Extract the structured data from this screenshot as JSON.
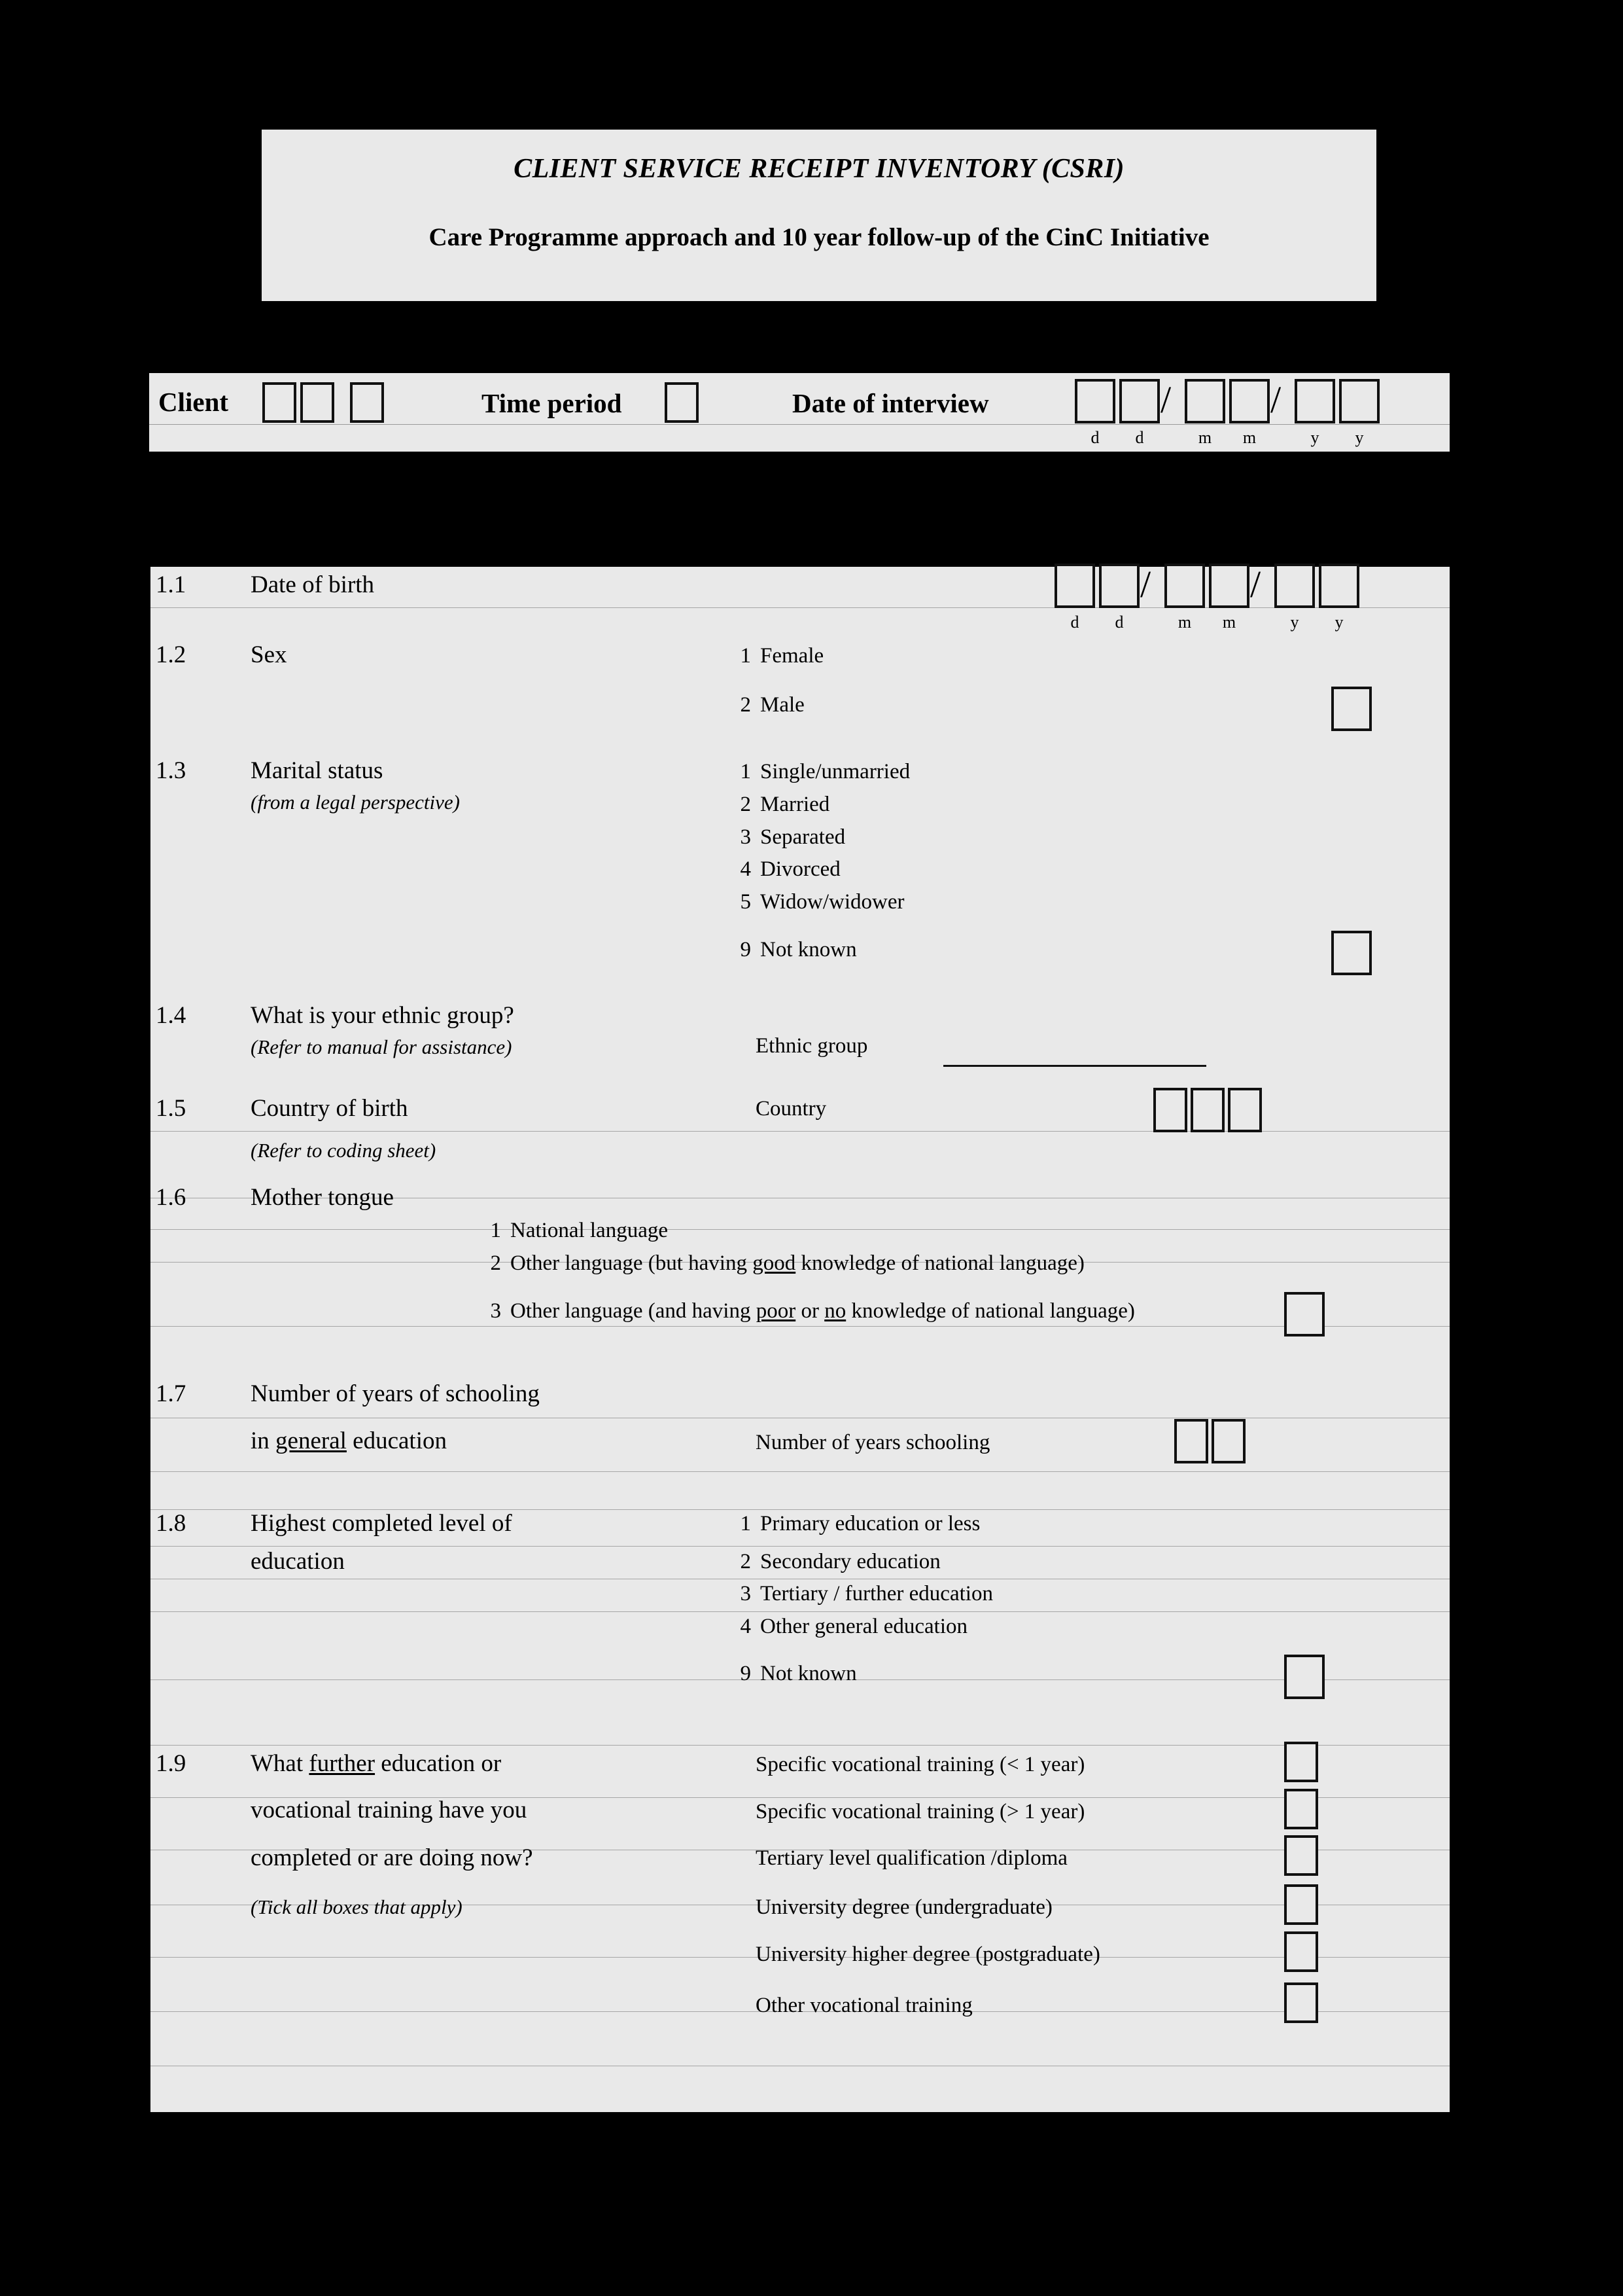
{
  "title": {
    "main": "CLIENT SERVICE RECEIPT INVENTORY (CSRI)",
    "sub": "Care Programme approach and 10 year follow-up of the CinC Initiative"
  },
  "header_strip": {
    "client_label": "Client",
    "time_period_label": "Time period",
    "date_of_interview_label": "Date of interview",
    "date_hints": [
      "d",
      "d",
      "m",
      "m",
      "y",
      "y"
    ],
    "client_box_count": 3,
    "time_period_box_count": 1,
    "date_box_count": 6,
    "separators": [
      "/",
      "/"
    ]
  },
  "questions": {
    "q1_1": {
      "number": "1.1",
      "text": "Date of birth",
      "date_hints": [
        "d",
        "d",
        "m",
        "m",
        "y",
        "y"
      ],
      "box_count": 6,
      "separators": [
        "/",
        "/"
      ]
    },
    "q1_2": {
      "number": "1.2",
      "text": "Sex",
      "options": [
        {
          "num": "1",
          "label": "Female"
        },
        {
          "num": "2",
          "label": "Male"
        }
      ]
    },
    "q1_3": {
      "number": "1.3",
      "text": "Marital status",
      "note": "(from a legal perspective)",
      "options": [
        {
          "num": "1",
          "label": "Single/unmarried"
        },
        {
          "num": "2",
          "label": "Married"
        },
        {
          "num": "3",
          "label": "Separated"
        },
        {
          "num": "4",
          "label": "Divorced"
        },
        {
          "num": "5",
          "label": "Widow/widower"
        },
        {
          "num": "9",
          "label": "Not known"
        }
      ]
    },
    "q1_4": {
      "number": "1.4",
      "text": "What is your ethnic group?",
      "note": "(Refer to manual for assistance)",
      "field_label": "Ethnic group"
    },
    "q1_5": {
      "number": "1.5",
      "text": "Country of birth",
      "note": "(Refer to coding sheet)",
      "field_label": "Country",
      "box_count": 3
    },
    "q1_6": {
      "number": "1.6",
      "text": "Mother tongue",
      "options": [
        {
          "num": "1",
          "pre": "National language",
          "u1": "",
          "mid": "",
          "u2": "",
          "post": ""
        },
        {
          "num": "2",
          "pre": "Other language (but having ",
          "u1": "good",
          "mid": " knowledge of national language)",
          "u2": "",
          "post": ""
        },
        {
          "num": "3",
          "pre": "Other language (and having ",
          "u1": "poor",
          "mid": " or  ",
          "u2": "no",
          "post": " knowledge of national language)"
        }
      ]
    },
    "q1_7": {
      "number": "1.7",
      "text_line1": "Number of years of schooling",
      "text_line2_pre": "in ",
      "text_line2_u": "general",
      "text_line2_post": " education",
      "field_label": "Number of years schooling",
      "box_count": 2
    },
    "q1_8": {
      "number": "1.8",
      "text_line1": "Highest completed level of",
      "text_line2": "education",
      "options": [
        {
          "num": "1",
          "label": "Primary education or less"
        },
        {
          "num": "2",
          "label": "Secondary education"
        },
        {
          "num": "3",
          "label": "Tertiary / further education"
        },
        {
          "num": "4",
          "label": "Other general education"
        },
        {
          "num": "9",
          "label": "Not known"
        }
      ]
    },
    "q1_9": {
      "number": "1.9",
      "text_line1_pre": "What ",
      "text_line1_u": "further",
      "text_line1_post": " education or",
      "text_line2": "vocational training have you",
      "text_line3": "completed or are doing now?",
      "note": "(Tick all boxes that apply)",
      "options": [
        {
          "label": "Specific vocational training (< 1 year)"
        },
        {
          "label": "Specific vocational training (> 1 year)"
        },
        {
          "label": "Tertiary level qualification /diploma"
        },
        {
          "label": "University degree (undergraduate)"
        },
        {
          "label": "University higher degree (postgraduate)"
        },
        {
          "label": "Other vocational training"
        }
      ]
    }
  },
  "colors": {
    "paper": "#e9e9e9",
    "page_background": "#000000",
    "rule": "#a6a6a6",
    "box_border": "#111111"
  }
}
